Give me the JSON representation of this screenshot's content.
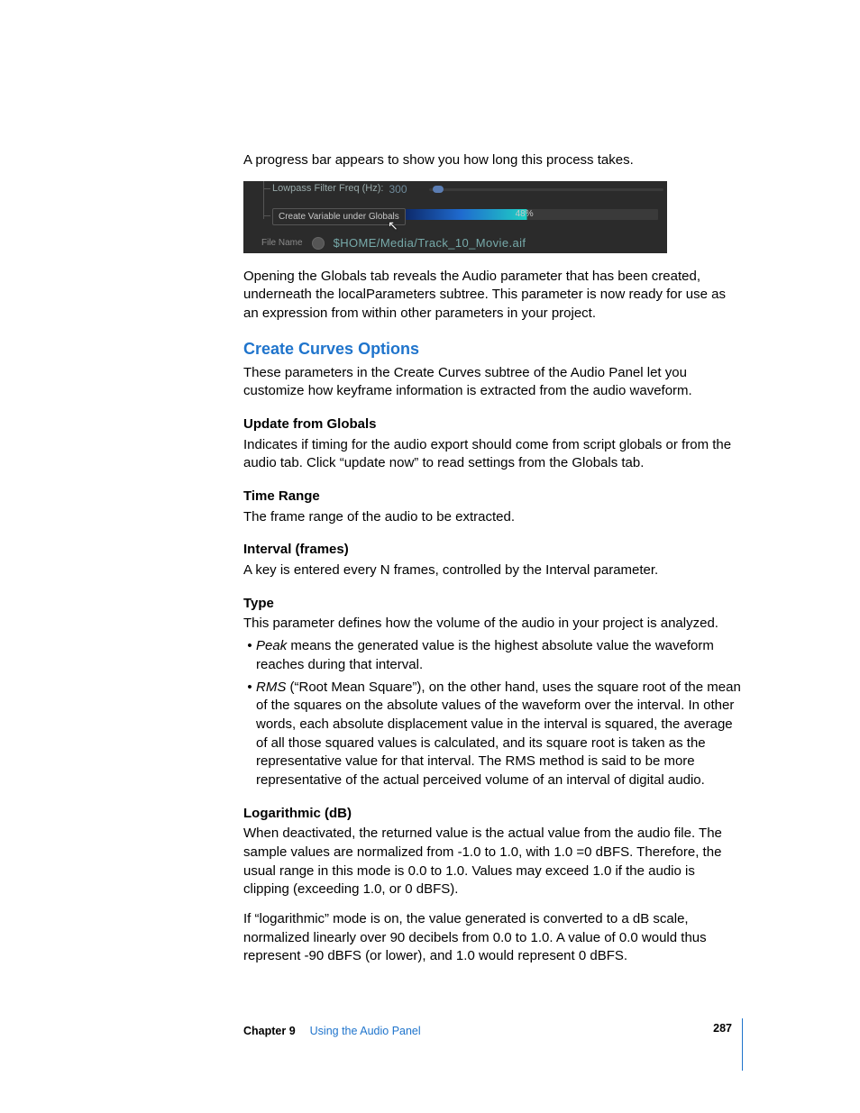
{
  "intro_line": "A progress bar appears to show you how long this process takes.",
  "ui": {
    "lowpass_label": "Lowpass Filter Freq (Hz):",
    "lowpass_value": "300",
    "button_label": "Create Variable under Globals",
    "progress_percent": "48%",
    "file_label": "File Name",
    "file_path": "$HOME/Media/Track_10_Movie.aif"
  },
  "para_globals": "Opening the Globals tab reveals the Audio parameter that has been created, underneath the localParameters subtree. This parameter is now ready for use as an expression from within other parameters in your project.",
  "section_heading": "Create Curves Options",
  "section_intro": "These parameters in the Create Curves subtree of the Audio Panel let you customize how keyframe information is extracted from the audio waveform.",
  "update_heading": "Update from Globals",
  "update_body": "Indicates if timing for the audio export should come from script globals or from the audio tab. Click “update now” to read settings from the Globals tab.",
  "time_heading": "Time Range",
  "time_body": "The frame range of the audio to be extracted.",
  "interval_heading": "Interval (frames)",
  "interval_body": "A key is entered every N frames, controlled by the Interval parameter.",
  "type_heading": "Type",
  "type_body": "This parameter defines how the volume of the audio in your project is analyzed.",
  "type_bullet1_em": "Peak",
  "type_bullet1_rest": " means the generated value is the highest absolute value the waveform reaches during that interval.",
  "type_bullet2_em": "RMS",
  "type_bullet2_rest": " (“Root Mean Square”), on the other hand, uses the square root of the mean of the squares on the absolute values of the waveform over the interval. In other words, each absolute displacement value in the interval is squared, the average of all those squared values is calculated, and its square root is taken as the representative value for that interval. The RMS method is said to be more representative of the actual perceived volume of an interval of digital audio.",
  "log_heading": "Logarithmic (dB)",
  "log_body1": "When deactivated, the returned value is the actual value from the audio file. The sample values are normalized from -1.0 to 1.0, with 1.0 =0 dBFS. Therefore, the usual range in this mode is 0.0 to 1.0. Values may exceed 1.0 if the audio is clipping (exceeding 1.0, or 0 dBFS).",
  "log_body2": "If “logarithmic” mode is on, the value generated is converted to a dB scale, normalized linearly over 90 decibels from 0.0 to 1.0. A value of 0.0 would thus represent -90 dBFS (or lower), and 1.0 would represent 0 dBFS.",
  "footer": {
    "chapter_label": "Chapter 9",
    "chapter_title": "Using the Audio Panel",
    "page_number": "287"
  }
}
